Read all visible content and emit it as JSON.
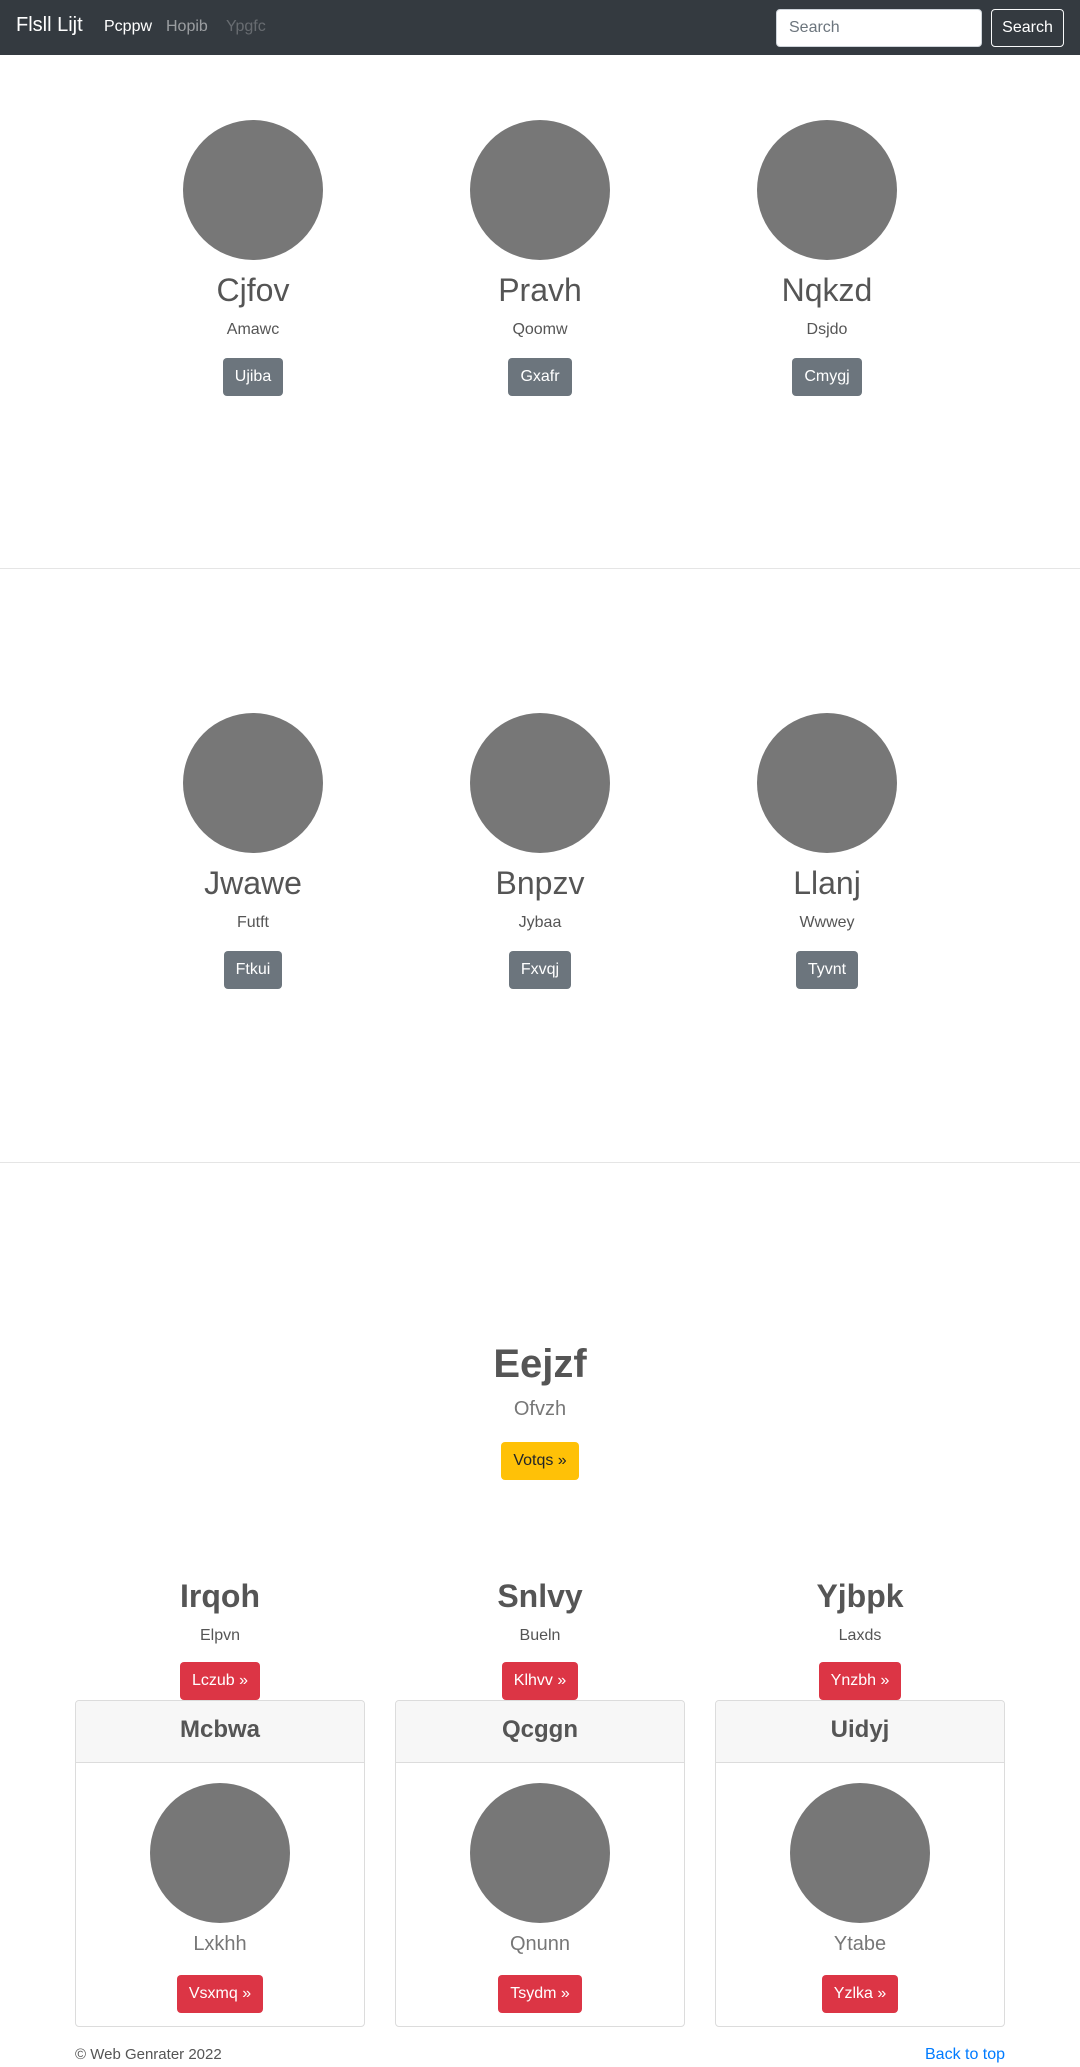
{
  "navbar": {
    "brand": "Flsll Lijt",
    "links": [
      "Pcppw",
      "Hopib",
      "Ypgfc"
    ],
    "search_placeholder": "Search",
    "search_button": "Search"
  },
  "profiles_row1": [
    {
      "name": "Cjfov",
      "sub": "Amawc",
      "button": "Ujiba"
    },
    {
      "name": "Pravh",
      "sub": "Qoomw",
      "button": "Gxafr"
    },
    {
      "name": "Nqkzd",
      "sub": "Dsjdo",
      "button": "Cmygj"
    }
  ],
  "profiles_row2": [
    {
      "name": "Jwawe",
      "sub": "Futft",
      "button": "Ftkui"
    },
    {
      "name": "Bnpzv",
      "sub": "Jybaa",
      "button": "Fxvqj"
    },
    {
      "name": "Llanj",
      "sub": "Wwwey",
      "button": "Tyvnt"
    }
  ],
  "hero": {
    "title": "Eejzf",
    "subtitle": "Ofvzh",
    "button": "Votqs »"
  },
  "features": [
    {
      "title": "Irqoh",
      "sub": "Elpvn",
      "button": "Lczub »"
    },
    {
      "title": "Snlvy",
      "sub": "Bueln",
      "button": "Klhvv »"
    },
    {
      "title": "Yjbpk",
      "sub": "Laxds",
      "button": "Ynzbh »"
    }
  ],
  "cards": [
    {
      "header": "Mcbwa",
      "sub": "Lxkhh",
      "button": "Vsxmq »"
    },
    {
      "header": "Qcggn",
      "sub": "Qnunn",
      "button": "Tsydm »"
    },
    {
      "header": "Uidyj",
      "sub": "Ytabe",
      "button": "Yzlka »"
    }
  ],
  "footer": {
    "copyright": "© Web Genrater 2022",
    "back_to_top": "Back to top"
  }
}
